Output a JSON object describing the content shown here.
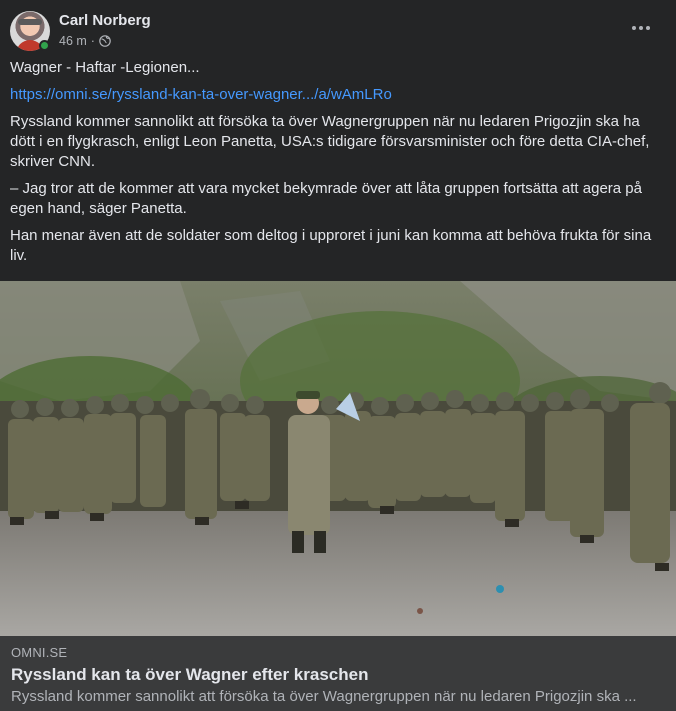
{
  "author": {
    "name": "Carl Norberg",
    "online": true
  },
  "meta": {
    "time": "46 m",
    "separator": "·",
    "audience_icon": "globe-icon"
  },
  "post": {
    "line1": "Wagner - Haftar -Legionen...",
    "link": "https://omni.se/ryssland-kan-ta-over-wagner.../a/wAmLRo",
    "para1": "Ryssland kommer sannolikt att försöka ta över Wagnergruppen när nu ledaren Prigozjin ska ha dött i en flygkrasch, enligt Leon Panetta, USA:s tidigare försvarsminister och före detta CIA-chef, skriver CNN.",
    "para2": "– Jag tror att de kommer att vara mycket bekymrade över att låta gruppen fortsätta att agera på egen hand, säger Panetta.",
    "para3": "Han menar även att de soldater som deltog i upproret i juni kan komma att behöva frukta för sina liv."
  },
  "preview": {
    "domain": "OMNI.SE",
    "title": "Ryssland kan ta över Wagner efter kraschen",
    "description": "Ryssland kommer sannolikt att försöka ta över Wagnergruppen när nu ledaren Prigozjin ska ..."
  },
  "colors": {
    "background": "#242526",
    "link": "#4599ff",
    "online": "#31a24c",
    "preview_bg": "#3a3b3c"
  }
}
